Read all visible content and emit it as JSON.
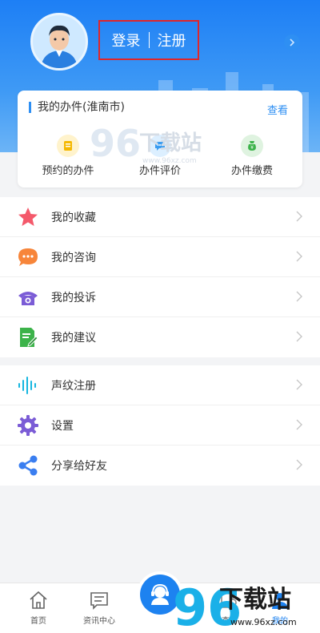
{
  "header": {
    "login_label": "登录",
    "register_label": "注册"
  },
  "affairs_card": {
    "title": "我的办件(淮南市)",
    "view_link": "查看",
    "items": [
      {
        "label": "预约的办件",
        "icon": "appointment-doc-icon",
        "color": "#f5b800"
      },
      {
        "label": "办件评价",
        "icon": "comment-icon",
        "color": "#3a9cf0"
      },
      {
        "label": "办件缴费",
        "icon": "payment-bag-icon",
        "color": "#3cb34a"
      }
    ]
  },
  "menu_group_1": [
    {
      "label": "我的收藏",
      "icon": "star-icon",
      "color": "#f4596b"
    },
    {
      "label": "我的咨询",
      "icon": "chat-bubble-icon",
      "color": "#f7853a"
    },
    {
      "label": "我的投诉",
      "icon": "telephone-icon",
      "color": "#7b5cd6"
    },
    {
      "label": "我的建议",
      "icon": "edit-document-icon",
      "color": "#3cb34a"
    }
  ],
  "menu_group_2": [
    {
      "label": "声纹注册",
      "icon": "voiceprint-icon",
      "color": "#16b6e0"
    },
    {
      "label": "设置",
      "icon": "gear-icon",
      "color": "#7b5cd6"
    },
    {
      "label": "分享给好友",
      "icon": "share-icon",
      "color": "#3a7ef0"
    }
  ],
  "tabbar": {
    "tabs": [
      {
        "label": "首页",
        "icon": "home-icon"
      },
      {
        "label": "资讯中心",
        "icon": "news-icon"
      },
      {
        "label": "查询",
        "icon": "search-icon"
      },
      {
        "label": "我的",
        "icon": "profile-icon"
      }
    ],
    "accent": "#1d82f0"
  },
  "watermark": {
    "brand_digits": "96",
    "brand_text": "下载站",
    "site": "www.96xz.com"
  }
}
